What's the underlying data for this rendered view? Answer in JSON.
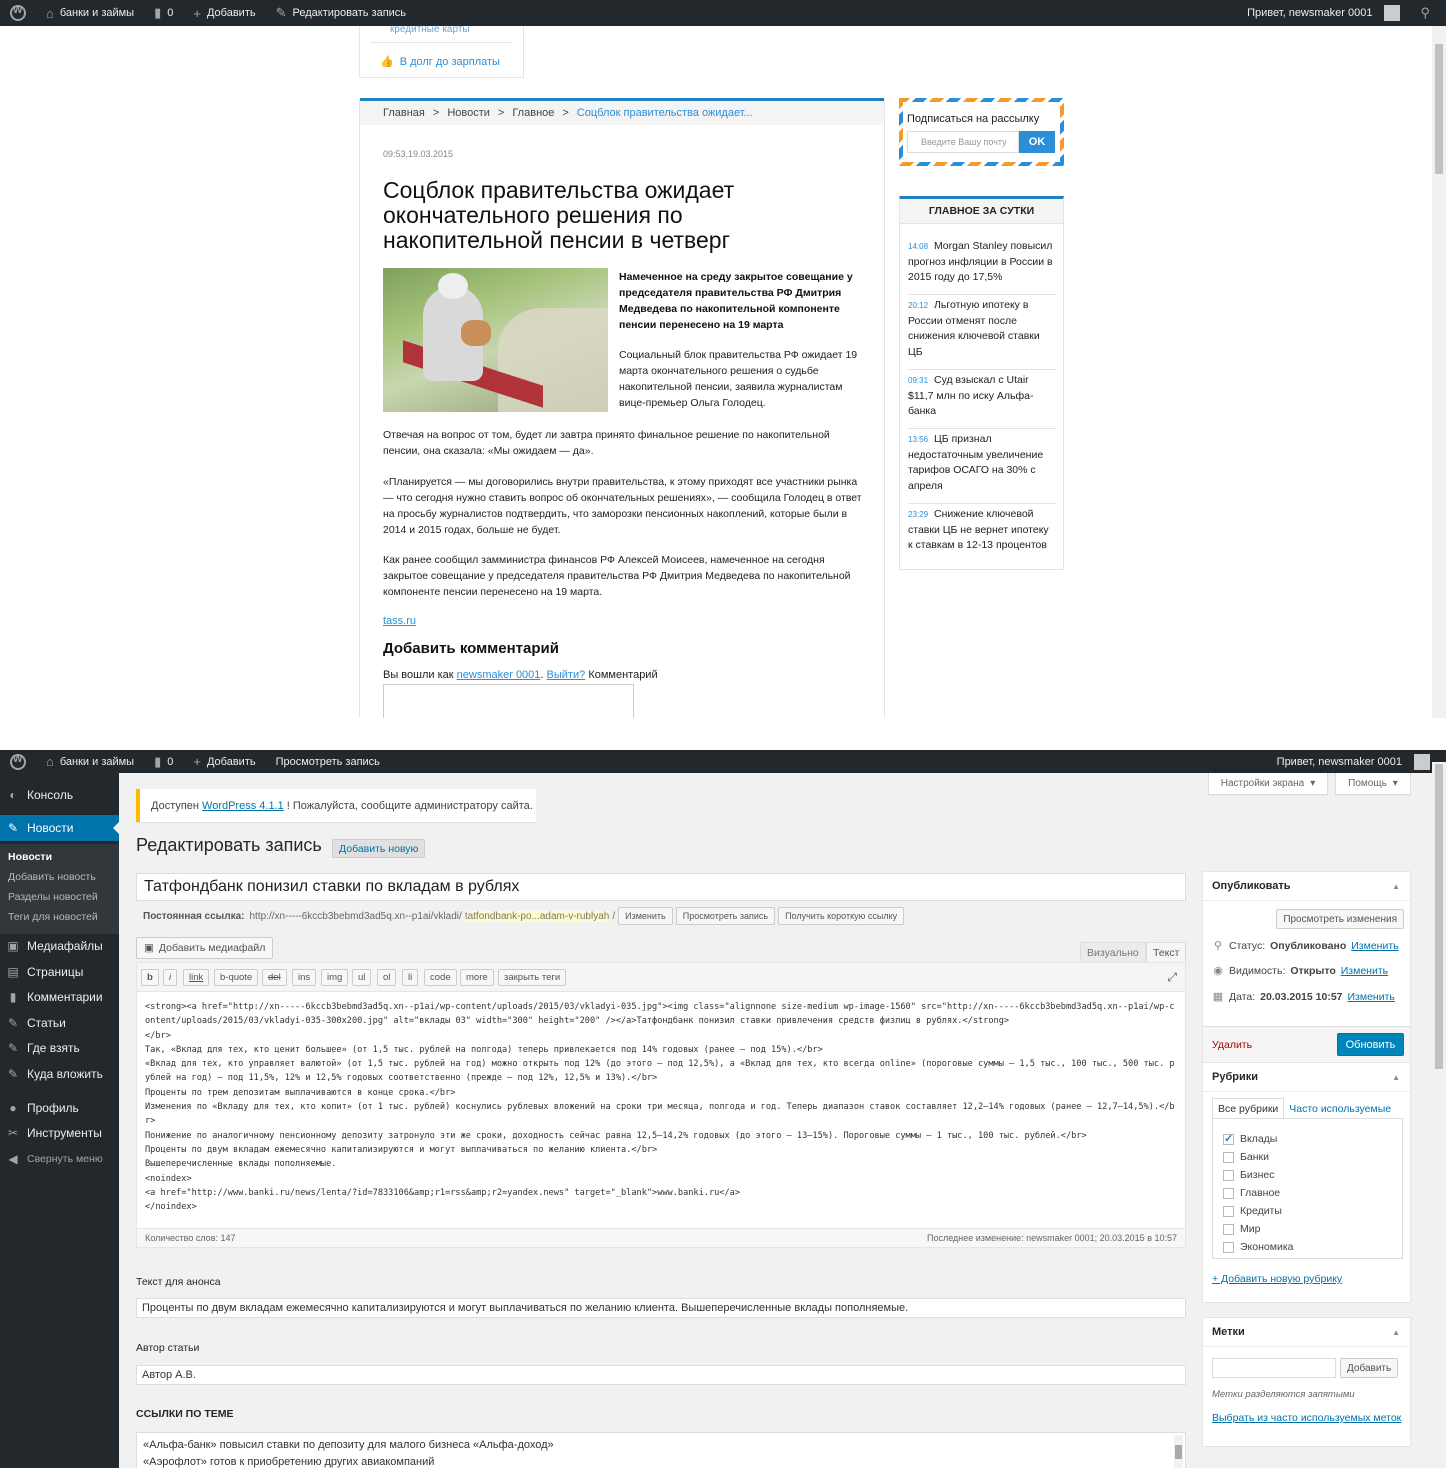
{
  "front": {
    "adminbar": {
      "site_name": "банки и займы",
      "comments_count": "0",
      "add_label": "Добавить",
      "edit_label": "Редактировать запись",
      "greeting": "Привет, newsmaker 0001"
    },
    "prev_menu": {
      "cut_item": "кредитные карты",
      "item": "В долг до зарплаты"
    },
    "breadcrumbs": [
      "Главная",
      "Новости",
      "Главное",
      "Соцблок правительства ожидает..."
    ],
    "breadcrumb_sep": ">",
    "article": {
      "date": "09:53,19.03.2015",
      "title": "Соцблок правительства ожидает окончательного решения по накопительной пенсии в четверг",
      "lead": "Намеченное на среду закрытое совещание у председателя правительства РФ Дмитрия Медведева по накопительной компоненте пенсии перенесено на 19 марта",
      "p1": "Социальный блок правительства РФ ожидает 19 марта окончательного решения о судьбе накопительной пенсии, заявила журналистам вице-премьер Ольга Голодец.",
      "p2": "Отвечая на вопрос от том, будет ли завтра принято финальное решение по накопительной пенсии, она сказала: «Мы ожидаем — да».",
      "p3": "«Планируется — мы договорились внутри правительства, к этому приходят все участники рынка — что сегодня нужно ставить вопрос об окончательных решениях», — сообщила Голодец в ответ на просьбу журналистов подтвердить, что заморозки пенсионных накоплений, которые были в 2014 и 2015 годах, больше не будет.",
      "p4": "Как ранее сообщил замминистра финансов РФ Алексей Моисеев, намеченное на сегодня закрытое совещание у председателя правительства РФ Дмитрия Медведева по накопительной компоненте пенсии перенесено на 19 марта.",
      "source": "tass.ru",
      "comment_heading": "Добавить комментарий",
      "logged_prefix": "Вы вошли как",
      "logged_user": "newsmaker 0001",
      "logout": "Выйти?",
      "comment_label": "Комментарий"
    },
    "subscribe": {
      "title": "Подписаться на рассылку",
      "placeholder": "Введите Вашу почту",
      "button": "OK"
    },
    "daily": {
      "heading": "ГЛАВНОЕ ЗА СУТКИ",
      "items": [
        {
          "time": "14:08",
          "text": "Morgan Stanley повысил прогноз инфляции в России в 2015 году до 17,5%"
        },
        {
          "time": "20:12",
          "text": "Льготную ипотеку в России отменят после снижения ключевой ставки ЦБ"
        },
        {
          "time": "09:31",
          "text": "Суд взыскал с Utair $11,7 млн по иску Альфа-банка"
        },
        {
          "time": "13:56",
          "text": "ЦБ признал недостаточным увеличение тарифов ОСАГО на 30% с апреля"
        },
        {
          "time": "23:29",
          "text": "Снижение ключевой ставки ЦБ не вернет ипотеку к ставкам в 12-13 процентов"
        }
      ]
    }
  },
  "admin": {
    "adminbar": {
      "site_name": "банки и займы",
      "comments_count": "0",
      "add_label": "Добавить",
      "view_label": "Просмотреть запись",
      "greeting": "Привет, newsmaker 0001"
    },
    "menu": {
      "console": "Консоль",
      "news": "Новости",
      "sub": [
        "Новости",
        "Добавить новость",
        "Разделы новостей",
        "Теги для новостей"
      ],
      "media": "Медиафайлы",
      "pages": "Страницы",
      "comments": "Комментарии",
      "articles": "Статьи",
      "where": "Где взять",
      "invest": "Куда вложить",
      "profile": "Профиль",
      "tools": "Инструменты",
      "collapse": "Свернуть меню"
    },
    "screen_options": "Настройки экрана",
    "help": "Помощь",
    "notice": {
      "before": "Доступен",
      "link": "WordPress 4.1.1",
      "after": "! Пожалуйста, сообщите администратору сайта."
    },
    "page_title": "Редактировать запись",
    "add_new": "Добавить новую",
    "post_title": "Татфондбанк понизил ставки по вкладам в рублях",
    "permalink": {
      "label": "Постоянная ссылка:",
      "url": "http://xn-----6kccb3bebmd3ad5q.xn--p1ai/vkladi/",
      "slug": "tatfondbank-po...adam-v-rublyah",
      "trail": "/",
      "btn_change": "Изменить",
      "btn_view": "Просмотреть запись",
      "btn_short": "Получить короткую ссылку"
    },
    "add_media": "Добавить медиафайл",
    "tab_visual": "Визуально",
    "tab_text": "Текст",
    "quicktags": [
      "b",
      "i",
      "link",
      "b-quote",
      "del",
      "ins",
      "img",
      "ul",
      "ol",
      "li",
      "code",
      "more",
      "закрыть теги"
    ],
    "content": "<strong><a href=\"http://xn-----6kccb3bebmd3ad5q.xn--p1ai/wp-content/uploads/2015/03/vkladyi-035.jpg\"><img class=\"alignnone size-medium wp-image-1560\" src=\"http://xn-----6kccb3bebmd3ad5q.xn--p1ai/wp-content/uploads/2015/03/vkladyi-035-300x200.jpg\" alt=\"вклады 03\" width=\"300\" height=\"200\" /></a>Татфондбанк понизил ставки привлечения средств физлиц в рублях.</strong>\n</br>\nТак, «Вклад для тех, кто ценит большее» (от 1,5 тыс. рублей на полгода) теперь привлекается под 14% годовых (ранее — под 15%).</br>\n«Вклад для тех, кто управляет валютой» (от 1,5 тыс. рублей на год) можно открыть под 12% (до этого — под 12,5%), а «Вклад для тех, кто всегда online» (пороговые суммы — 1,5 тыс., 100 тыс., 500 тыс. рублей на год) — под 11,5%, 12% и 12,5% годовых соответственно (прежде — под 12%, 12,5% и 13%).</br>\nПроценты по трем депозитам выплачиваются в конце срока.</br>\nИзменения по «Вкладу для тех, кто копит» (от 1 тыс. рублей) коснулись рублевых вложений на сроки три месяца, полгода и год. Теперь диапазон ставок составляет 12,2–14% годовых (ранее — 12,7–14,5%).</br>\nПонижение по аналогичному пенсионному депозиту затронуло эти же сроки, доходность сейчас равна 12,5–14,2% годовых (до этого — 13–15%). Пороговые суммы — 1 тыс., 100 тыс. рублей.</br>\nПроценты по двум вкладам ежемесячно капитализируются и могут выплачиваться по желанию клиента.</br>\nВышеперечисленные вклады пополняемые.\n<noindex>\n<a href=\"http://www.banki.ru/news/lenta/?id=7833106&amp;r1=rss&amp;r2=yandex.news\" target=\"_blank\">www.banki.ru</a>\n</noindex>",
    "word_count": "Количество слов: 147",
    "last_edit": "Последнее изменение: newsmaker 0001; 20.03.2015 в 10:57",
    "excerpt_label": "Текст для анонса",
    "excerpt": "Проценты по двум вкладам ежемесячно капитализируются и могут выплачиваться по желанию клиента. Вышеперечисленные вклады пополняемые.",
    "author_label": "Автор статьи",
    "author": "Автор А.В.",
    "links_label": "ССЫЛКИ ПО ТЕМЕ",
    "links": [
      "«Альфа-банк» повысил ставки по депозиту для малого бизнеса «Альфа-доход»",
      "«Аэрофлот» готов к приобретению других авиакомпаний"
    ],
    "publish": {
      "title": "Опубликовать",
      "preview": "Просмотреть изменения",
      "status_label": "Статус:",
      "status": "Опубликовано",
      "visibility_label": "Видимость:",
      "visibility": "Открыто",
      "date_label": "Дата:",
      "date": "20.03.2015 10:57",
      "edit": "Изменить",
      "delete": "Удалить",
      "update": "Обновить"
    },
    "categories": {
      "title": "Рубрики",
      "tab_all": "Все рубрики",
      "tab_popular": "Часто используемые",
      "items": [
        "Вклады",
        "Банки",
        "Бизнес",
        "Главное",
        "Кредиты",
        "Мир",
        "Экономика"
      ],
      "add_new": "+ Добавить новую рубрику"
    },
    "tags": {
      "title": "Метки",
      "add": "Добавить",
      "hint": "Метки разделяются запятыми",
      "choose": "Выбрать из часто используемых меток"
    }
  }
}
